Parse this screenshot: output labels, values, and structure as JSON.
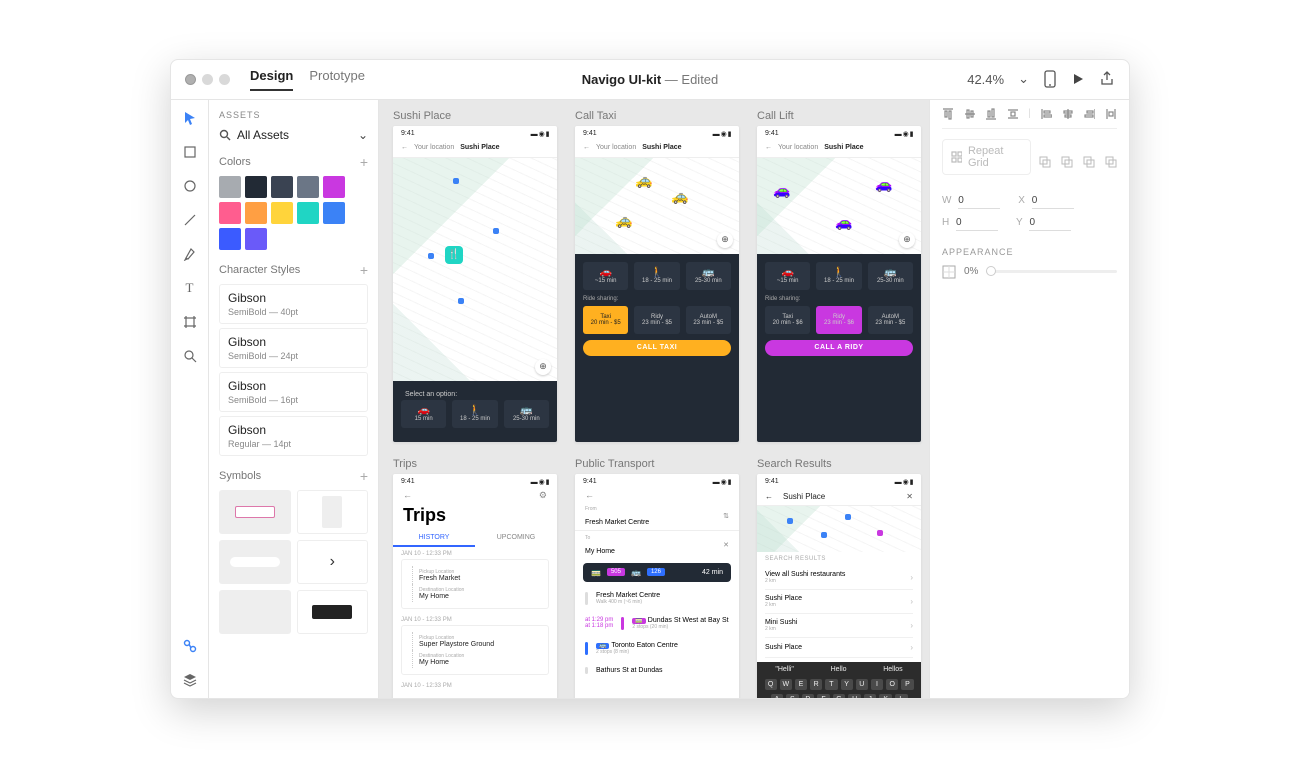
{
  "header": {
    "tab_design": "Design",
    "tab_prototype": "Prototype",
    "title": "Navigo UI-kit",
    "edited": "—  Edited",
    "zoom": "42.4%"
  },
  "assets": {
    "heading": "ASSETS",
    "all": "All Assets",
    "colors_title": "Colors",
    "colors": [
      "#a7abb0",
      "#222a35",
      "#3a4352",
      "#6b7686",
      "#c938e0",
      "#ff5d8f",
      "#ff9f43",
      "#ffd43b",
      "#20d5c4",
      "#3b82f6",
      "#3b5bff",
      "#6a5af9"
    ],
    "char_title": "Character Styles",
    "char_styles": [
      {
        "name": "Gibson",
        "sub": "SemiBold — 40pt"
      },
      {
        "name": "Gibson",
        "sub": "SemiBold — 24pt"
      },
      {
        "name": "Gibson",
        "sub": "SemiBold — 16pt"
      },
      {
        "name": "Gibson",
        "sub": "Regular — 14pt"
      }
    ],
    "symbols_title": "Symbols"
  },
  "artboards": {
    "r1": [
      {
        "label": "Sushi Place",
        "time": "9:41",
        "your": "Your location",
        "dest": "Sushi Place",
        "panel": "dark_options",
        "opt_title": "Select an option:",
        "opt": "sushi"
      },
      {
        "label": "Call Taxi",
        "time": "9:41",
        "your": "Your location",
        "dest": "Sushi Place",
        "panel": "taxi_panel"
      },
      {
        "label": "Call Lift",
        "time": "9:41",
        "your": "Your location",
        "dest": "Sushi Place",
        "panel": "lift_panel"
      }
    ],
    "r2": [
      {
        "label": "Trips",
        "time": "9:41"
      },
      {
        "label": "Public Transport",
        "time": "9:41"
      },
      {
        "label": "Search Results",
        "time": "9:41"
      }
    ]
  },
  "sushi": {
    "select": "Select an option:",
    "opts": [
      {
        "i": "🚗",
        "t": "15 min"
      },
      {
        "i": "🚶",
        "t": "18 - 25 min"
      },
      {
        "i": "🚌",
        "t": "25-30 min"
      }
    ]
  },
  "taxi": {
    "share": "Ride sharing:",
    "top": [
      {
        "i": "🚗",
        "t": "~15 min"
      },
      {
        "i": "🚶",
        "t": "18 - 25 min"
      },
      {
        "i": "🚌",
        "t": "25-30 min"
      }
    ],
    "opts": [
      {
        "n": "Taxi",
        "s": "20 min - $5"
      },
      {
        "n": "Ridy",
        "s": "23 min - $5"
      },
      {
        "n": "AutoM",
        "s": "23 min - $5"
      }
    ],
    "cta": "CALL TAXI"
  },
  "lift": {
    "share": "Ride sharing:",
    "top": [
      {
        "i": "🚗",
        "t": "~15 min"
      },
      {
        "i": "🚶",
        "t": "18 - 25 min"
      },
      {
        "i": "🚌",
        "t": "25-30 min"
      }
    ],
    "opts": [
      {
        "n": "Taxi",
        "s": "20 min - $6"
      },
      {
        "n": "Ridy",
        "s": "23 min - $6"
      },
      {
        "n": "AutoM",
        "s": "23 min - $5"
      }
    ],
    "cta": "CALL A RIDY"
  },
  "trips": {
    "title": "Trips",
    "tab_history": "HISTORY",
    "tab_upcoming": "UPCOMING",
    "d1": "JAN 10 - 12:33 PM",
    "c1": {
      "pl": "Pickup Location",
      "pv": "Fresh Market",
      "dl": "Destination Location",
      "dv": "My Home"
    },
    "d2": "JAN 10 - 12:33 PM",
    "c2": {
      "pl": "Pickup Location",
      "pv": "Super Playstore Ground",
      "dl": "Destination Location",
      "dv": "My Home"
    },
    "d3": "JAN 10 - 12:33 PM"
  },
  "pt": {
    "from_l": "From",
    "from": "Fresh Market Centre",
    "to_l": "To",
    "to": "My Home",
    "route505": "505",
    "route126": "126",
    "duration": "42 min",
    "s1": {
      "t": "Fresh Market Centre",
      "m": "Walk 400 m (~6 min)"
    },
    "s2": {
      "badge": "505",
      "t": "Dundas St West at Bay St",
      "m": "2 stops (20 min)",
      "time": "at 1:29 pm\nat 1:18 pm"
    },
    "s3": {
      "badge": "126",
      "t": "Toronto Eaton Centre",
      "m": "2 stops (8 min)"
    },
    "s4": {
      "t": "Bathurs St at Dundas"
    }
  },
  "search": {
    "title": "Sushi Place",
    "heading": "SEARCH RESULTS",
    "items": [
      {
        "t": "View all Sushi restaurants",
        "s": "2 km"
      },
      {
        "t": "Sushi Place",
        "s": "2 km"
      },
      {
        "t": "Mini Sushi",
        "s": "2 km"
      },
      {
        "t": "Sushi Place",
        "s": ""
      }
    ],
    "sug": [
      "\"Helli\"",
      "Hello",
      "Hellos"
    ],
    "row1": [
      "Q",
      "W",
      "E",
      "R",
      "T",
      "Y",
      "U",
      "I",
      "O",
      "P"
    ],
    "row2": [
      "A",
      "S",
      "D",
      "F",
      "G",
      "H",
      "J",
      "K",
      "L"
    ]
  },
  "props": {
    "repeat": "Repeat Grid",
    "W": "W",
    "Wv": "0",
    "X": "X",
    "Xv": "0",
    "H": "H",
    "Hv": "0",
    "Y": "Y",
    "Yv": "0",
    "appearance": "APPEARANCE",
    "opacity": "0%"
  }
}
